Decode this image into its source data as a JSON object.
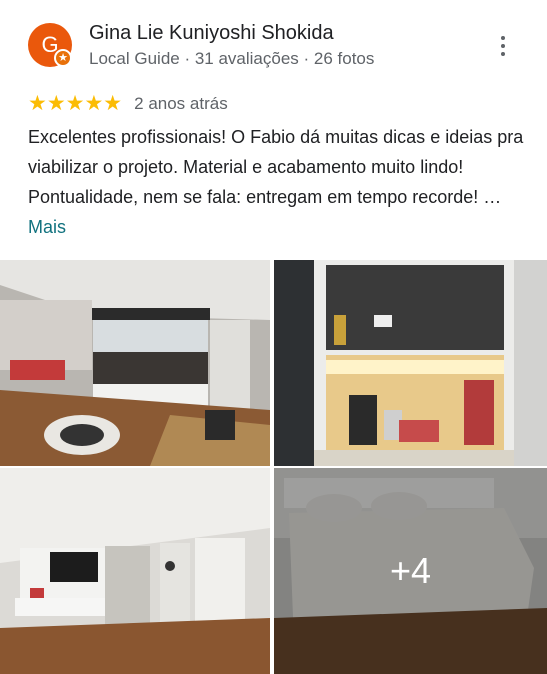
{
  "reviewer": {
    "initial": "G",
    "name": "Gina Lie Kuniyoshi Shokida",
    "meta": "Local Guide · 31 avaliações · 26 fotos",
    "avatar_color": "#ea580c"
  },
  "review": {
    "stars": 5,
    "stars_text": "★★★★★",
    "date": "2 anos atrás",
    "text": "Excelentes profissionais! O Fabio dá muitas dicas e ideias pra viabilizar o projeto.  Material e acabamento muito lindo! Pontualidade,  nem se fala: entregam em tempo recorde! …",
    "more_link": "Mais",
    "star_color": "#fbbc04"
  },
  "photos": {
    "items": [
      {
        "icon": "living-room-photo"
      },
      {
        "icon": "kitchen-shelf-photo"
      },
      {
        "icon": "tv-wall-photo"
      },
      {
        "icon": "bedroom-photo"
      }
    ],
    "more_count": "+4"
  }
}
